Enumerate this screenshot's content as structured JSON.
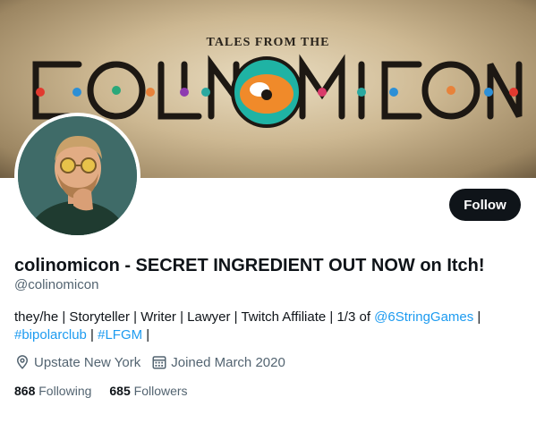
{
  "banner": {
    "kicker": "TALES FROM THE",
    "logo_text": "COLINOMICON"
  },
  "profile": {
    "display_name": "colinomicon - SECRET INGREDIENT OUT NOW on Itch!",
    "handle": "@colinomicon",
    "follow_label": "Follow",
    "bio": {
      "text_start": "they/he | Storyteller | Writer | Lawyer | Twitch Affiliate | 1/3 of ",
      "link_1": "@6StringGames",
      "sep_1": " |",
      "link_2": "#bipolarclub",
      "sep_2": " | ",
      "link_3": "#LFGM",
      "sep_3": " |"
    },
    "location": "Upstate New York",
    "joined": "Joined March 2020",
    "following_count": "868",
    "following_label": "Following",
    "followers_count": "685",
    "followers_label": "Followers"
  },
  "icons": {
    "location": "map-pin-icon",
    "joined": "calendar-icon"
  },
  "colors": {
    "link": "#1d9bf0",
    "follow_bg": "#0f1419",
    "secondary_text": "#536471"
  }
}
